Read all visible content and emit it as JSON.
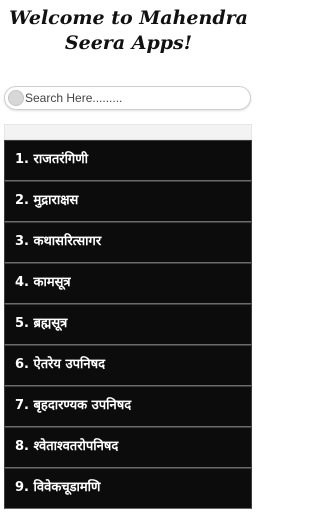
{
  "header": {
    "title": "Welcome to Mahendra Seera Apps!"
  },
  "search": {
    "placeholder": "Search Here........."
  },
  "list": {
    "items": [
      "1. राजतरंगिणी",
      "2. मुद्राराक्षस",
      "3. कथासरित्सागर",
      "4. कामसूत्र",
      "5. ब्रह्मसूत्र",
      "6. ऐतरेय उपनिषद",
      "7. बृहदारण्यक उपनिषद",
      "8. श्वेताश्वतरोपनिषद",
      "9. विवेकचूडामणि"
    ]
  },
  "colors": {
    "item_background": "#0c0c0c",
    "item_text": "#ffffff",
    "page_background": "#ffffff"
  }
}
